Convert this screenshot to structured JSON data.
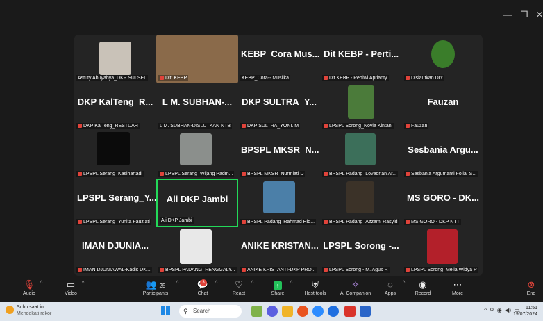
{
  "tiles": [
    {
      "big": "",
      "label": "Astuty Abuyahya_DKP SULSEL",
      "muted": false
    },
    {
      "big": "",
      "label": "Dit. KEBP",
      "muted": true
    },
    {
      "big": "KEBP_Cora Mus...",
      "label": "KEBP_Cora-- Muslika",
      "muted": false
    },
    {
      "big": "Dit KEBP - Perti...",
      "label": "Dit KEBP - Pertiwi Aprianty",
      "muted": true
    },
    {
      "big": "",
      "label": "Dislautkan DIY",
      "muted": true
    },
    {
      "big": "DKP KalTeng_R...",
      "label": "DKP KalTeng_RESTUAH",
      "muted": true
    },
    {
      "big": "L M. SUBHAN-...",
      "label": "L M. SUBHAN-DISLUTKAN NTB",
      "muted": false
    },
    {
      "big": "DKP SULTRA_Y...",
      "label": "DKP SULTRA_YONI. M",
      "muted": true
    },
    {
      "big": "",
      "label": "LPSPL Sorong_Novia Kintani",
      "muted": true
    },
    {
      "big": "Fauzan",
      "label": "Fauzan",
      "muted": true
    },
    {
      "big": "",
      "label": "LPSPL Serang_Kasihartadi",
      "muted": true
    },
    {
      "big": "",
      "label": "LPSPL Serang_Wijang Padm...",
      "muted": true
    },
    {
      "big": "BPSPL MKSR_N...",
      "label": "BPSPL MKSR_Nurmiati D",
      "muted": true
    },
    {
      "big": "",
      "label": "BPSPL Padang_Lovedrian Ar...",
      "muted": true
    },
    {
      "big": "Sesbania Argu...",
      "label": "Sesbania Argumanti Folia_S...",
      "muted": true
    },
    {
      "big": "LPSPL Serang_Y...",
      "label": "LPSPL Serang_Yunita Fauziati",
      "muted": true
    },
    {
      "big": "Ali DKP Jambi",
      "label": "Ali DKP Jambi",
      "muted": false
    },
    {
      "big": "",
      "label": "BPSPL Padang_Rahmad Hid...",
      "muted": true
    },
    {
      "big": "",
      "label": "BPSPL Padang_Azzami Rasyid",
      "muted": true
    },
    {
      "big": "MS GORO - DK...",
      "label": "MS GORO - DKP NTT",
      "muted": true
    },
    {
      "big": "IMAN DJUNIA...",
      "label": "IMAN DJUNIAWAL-Kadis DK...",
      "muted": true
    },
    {
      "big": "",
      "label": "BPSPL PADANG_RENGGALY...",
      "muted": true
    },
    {
      "big": "ANIKE KRISTAN...",
      "label": "ANIKE KRISTANTI-DKP PRO...",
      "muted": true
    },
    {
      "big": "LPSPL Sorong -...",
      "label": "LPSPL Sorong - M. Agus R",
      "muted": true
    },
    {
      "big": "",
      "label": "LPSPL Sorong_Melia Widya P",
      "muted": true
    }
  ],
  "toolbar": {
    "audio": "Audio",
    "video": "Video",
    "participants": "Participants",
    "participants_count": "25",
    "chat": "Chat",
    "chat_badge": "3",
    "react": "React",
    "share": "Share",
    "host_tools": "Host tools",
    "ai_companion": "AI Companion",
    "apps": "Apps",
    "record": "Record",
    "more": "More",
    "end": "End"
  },
  "taskbar": {
    "weather_title": "Suhu saat ini",
    "weather_sub": "Mendekati rekor",
    "search_placeholder": "Search",
    "time": "11:51",
    "date": "19/07/2024"
  },
  "colors": {
    "active_speaker": "#23d959",
    "muted": "#e0433a",
    "background": "#242424"
  }
}
